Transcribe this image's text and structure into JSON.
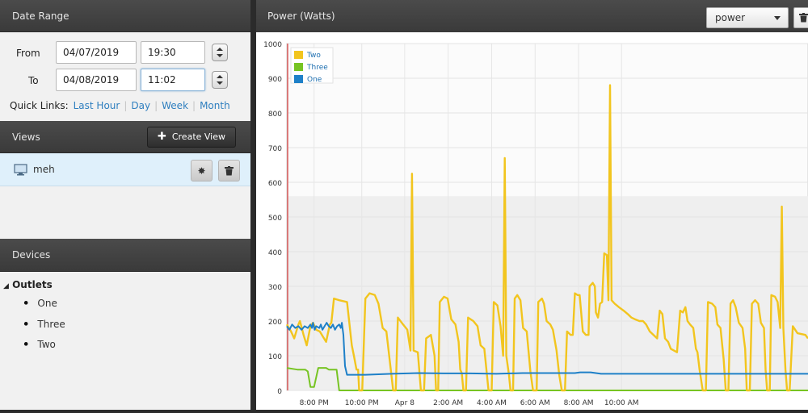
{
  "date_range": {
    "header": "Date Range",
    "from_label": "From",
    "from_date": "04/07/2019",
    "from_time": "19:30",
    "to_label": "To",
    "to_date": "04/08/2019",
    "to_time": "11:02",
    "quick_links_label": "Quick Links:",
    "quick_links": [
      "Last Hour",
      "Day",
      "Week",
      "Month"
    ]
  },
  "views": {
    "header": "Views",
    "create_label": "Create View",
    "items": [
      {
        "name": "meh"
      }
    ]
  },
  "devices": {
    "header": "Devices",
    "group": "Outlets",
    "items": [
      "One",
      "Three",
      "Two"
    ]
  },
  "main": {
    "title": "Power (Watts)",
    "metric_select": "power"
  },
  "colors": {
    "two": "#f2c51e",
    "three": "#77c423",
    "one": "#1e80c8"
  },
  "chart_data": {
    "type": "line",
    "ylim": [
      0,
      1000
    ],
    "yticks": [
      0,
      100,
      200,
      300,
      400,
      500,
      600,
      700,
      800,
      900,
      1000
    ],
    "xlim": [
      "19:30",
      "11:02"
    ],
    "xticks": [
      "8:00 PM",
      "10:00 PM",
      "Apr 8",
      "2:00 AM",
      "4:00 AM",
      "6:00 AM",
      "8:00 AM",
      "10:00 AM"
    ],
    "legend": "top-left",
    "series": [
      {
        "name": "Two",
        "points": [
          [
            0,
            190
          ],
          [
            8,
            170
          ],
          [
            14,
            150
          ],
          [
            22,
            190
          ],
          [
            25,
            200
          ],
          [
            32,
            160
          ],
          [
            38,
            130
          ],
          [
            45,
            185
          ],
          [
            50,
            195
          ],
          [
            56,
            175
          ],
          [
            63,
            170
          ],
          [
            69,
            155
          ],
          [
            75,
            140
          ],
          [
            82,
            190
          ],
          [
            85,
            195
          ],
          [
            90,
            265
          ],
          [
            100,
            260
          ],
          [
            115,
            255
          ],
          [
            124,
            130
          ],
          [
            128,
            100
          ],
          [
            133,
            60
          ],
          [
            136,
            60
          ],
          [
            138,
            0
          ],
          [
            144,
            0
          ],
          [
            150,
            265
          ],
          [
            158,
            280
          ],
          [
            168,
            275
          ],
          [
            175,
            250
          ],
          [
            183,
            180
          ],
          [
            190,
            170
          ],
          [
            198,
            65
          ],
          [
            203,
            0
          ],
          [
            208,
            0
          ],
          [
            212,
            210
          ],
          [
            222,
            190
          ],
          [
            230,
            175
          ],
          [
            236,
            115
          ],
          [
            239,
            625
          ],
          [
            242,
            115
          ],
          [
            250,
            110
          ],
          [
            256,
            0
          ],
          [
            262,
            0
          ],
          [
            266,
            150
          ],
          [
            275,
            160
          ],
          [
            282,
            100
          ],
          [
            285,
            0
          ],
          [
            289,
            0
          ],
          [
            292,
            255
          ],
          [
            300,
            270
          ],
          [
            307,
            265
          ],
          [
            314,
            205
          ],
          [
            322,
            190
          ],
          [
            328,
            140
          ],
          [
            331,
            60
          ],
          [
            334,
            50
          ],
          [
            337,
            0
          ],
          [
            342,
            0
          ],
          [
            346,
            210
          ],
          [
            356,
            200
          ],
          [
            364,
            185
          ],
          [
            370,
            130
          ],
          [
            377,
            120
          ],
          [
            385,
            0
          ],
          [
            391,
            0
          ],
          [
            395,
            255
          ],
          [
            402,
            245
          ],
          [
            408,
            185
          ],
          [
            413,
            100
          ],
          [
            416,
            670
          ],
          [
            419,
            100
          ],
          [
            424,
            45
          ],
          [
            427,
            0
          ],
          [
            432,
            0
          ],
          [
            435,
            265
          ],
          [
            440,
            275
          ],
          [
            446,
            260
          ],
          [
            451,
            180
          ],
          [
            458,
            170
          ],
          [
            465,
            55
          ],
          [
            470,
            0
          ],
          [
            477,
            0
          ],
          [
            480,
            255
          ],
          [
            487,
            265
          ],
          [
            491,
            250
          ],
          [
            496,
            200
          ],
          [
            503,
            190
          ],
          [
            508,
            175
          ],
          [
            515,
            115
          ],
          [
            520,
            45
          ],
          [
            525,
            0
          ],
          [
            531,
            0
          ],
          [
            535,
            170
          ],
          [
            542,
            160
          ],
          [
            546,
            160
          ],
          [
            550,
            280
          ],
          [
            555,
            275
          ],
          [
            559,
            275
          ],
          [
            565,
            170
          ],
          [
            571,
            160
          ],
          [
            576,
            160
          ],
          [
            578,
            300
          ],
          [
            584,
            310
          ],
          [
            588,
            300
          ],
          [
            590,
            225
          ],
          [
            594,
            210
          ],
          [
            598,
            250
          ],
          [
            602,
            255
          ],
          [
            606,
            395
          ],
          [
            611,
            390
          ],
          [
            614,
            260
          ],
          [
            617,
            880
          ],
          [
            620,
            260
          ],
          [
            626,
            250
          ],
          [
            634,
            240
          ],
          [
            643,
            230
          ],
          [
            651,
            220
          ],
          [
            658,
            210
          ],
          [
            665,
            205
          ],
          [
            673,
            200
          ],
          [
            680,
            200
          ],
          [
            686,
            190
          ],
          [
            693,
            170
          ],
          [
            700,
            160
          ],
          [
            707,
            150
          ],
          [
            712,
            230
          ],
          [
            717,
            220
          ],
          [
            722,
            150
          ],
          [
            728,
            140
          ],
          [
            733,
            120
          ],
          [
            739,
            115
          ],
          [
            745,
            110
          ],
          [
            751,
            230
          ],
          [
            756,
            225
          ],
          [
            761,
            240
          ],
          [
            765,
            200
          ],
          [
            770,
            190
          ],
          [
            776,
            180
          ],
          [
            781,
            120
          ],
          [
            784,
            110
          ],
          [
            788,
            60
          ],
          [
            794,
            0
          ],
          [
            800,
            0
          ],
          [
            804,
            255
          ],
          [
            812,
            250
          ],
          [
            818,
            240
          ],
          [
            822,
            190
          ],
          [
            828,
            180
          ],
          [
            834,
            90
          ],
          [
            838,
            0
          ],
          [
            843,
            0
          ],
          [
            847,
            250
          ],
          [
            852,
            260
          ],
          [
            857,
            240
          ],
          [
            863,
            195
          ],
          [
            870,
            180
          ],
          [
            875,
            120
          ],
          [
            878,
            0
          ],
          [
            884,
            0
          ],
          [
            888,
            250
          ],
          [
            894,
            260
          ],
          [
            900,
            250
          ],
          [
            905,
            195
          ],
          [
            911,
            180
          ],
          [
            914,
            60
          ],
          [
            917,
            0
          ],
          [
            922,
            0
          ],
          [
            925,
            275
          ],
          [
            932,
            270
          ],
          [
            937,
            255
          ],
          [
            942,
            180
          ],
          [
            945,
            530
          ],
          [
            948,
            180
          ],
          [
            952,
            60
          ],
          [
            955,
            0
          ],
          [
            960,
            0
          ],
          [
            966,
            185
          ],
          [
            975,
            165
          ],
          [
            990,
            160
          ],
          [
            995,
            150
          ]
        ]
      },
      {
        "name": "Three",
        "points": [
          [
            0,
            65
          ],
          [
            20,
            60
          ],
          [
            35,
            60
          ],
          [
            40,
            55
          ],
          [
            45,
            10
          ],
          [
            52,
            10
          ],
          [
            60,
            65
          ],
          [
            75,
            65
          ],
          [
            80,
            60
          ],
          [
            95,
            60
          ],
          [
            100,
            0
          ],
          [
            140,
            0
          ],
          [
            200,
            0
          ],
          [
            300,
            0
          ],
          [
            400,
            0
          ],
          [
            500,
            0
          ],
          [
            600,
            0
          ],
          [
            700,
            0
          ],
          [
            800,
            0
          ],
          [
            900,
            0
          ],
          [
            995,
            0
          ]
        ]
      },
      {
        "name": "One",
        "points": [
          [
            0,
            185
          ],
          [
            5,
            175
          ],
          [
            10,
            190
          ],
          [
            16,
            180
          ],
          [
            22,
            185
          ],
          [
            28,
            175
          ],
          [
            34,
            185
          ],
          [
            40,
            180
          ],
          [
            45,
            190
          ],
          [
            48,
            180
          ],
          [
            50,
            195
          ],
          [
            53,
            175
          ],
          [
            56,
            185
          ],
          [
            62,
            180
          ],
          [
            65,
            190
          ],
          [
            68,
            175
          ],
          [
            72,
            185
          ],
          [
            76,
            195
          ],
          [
            80,
            185
          ],
          [
            84,
            180
          ],
          [
            88,
            190
          ],
          [
            92,
            175
          ],
          [
            96,
            185
          ],
          [
            100,
            190
          ],
          [
            103,
            180
          ],
          [
            105,
            195
          ],
          [
            108,
            160
          ],
          [
            111,
            70
          ],
          [
            115,
            45
          ],
          [
            125,
            45
          ],
          [
            150,
            45
          ],
          [
            200,
            48
          ],
          [
            250,
            50
          ],
          [
            300,
            49
          ],
          [
            350,
            49
          ],
          [
            400,
            48
          ],
          [
            450,
            50
          ],
          [
            500,
            50
          ],
          [
            550,
            50
          ],
          [
            560,
            52
          ],
          [
            580,
            52
          ],
          [
            600,
            48
          ],
          [
            650,
            48
          ],
          [
            700,
            48
          ],
          [
            750,
            48
          ],
          [
            800,
            48
          ],
          [
            850,
            48
          ],
          [
            900,
            48
          ],
          [
            950,
            48
          ],
          [
            995,
            48
          ]
        ]
      }
    ]
  }
}
